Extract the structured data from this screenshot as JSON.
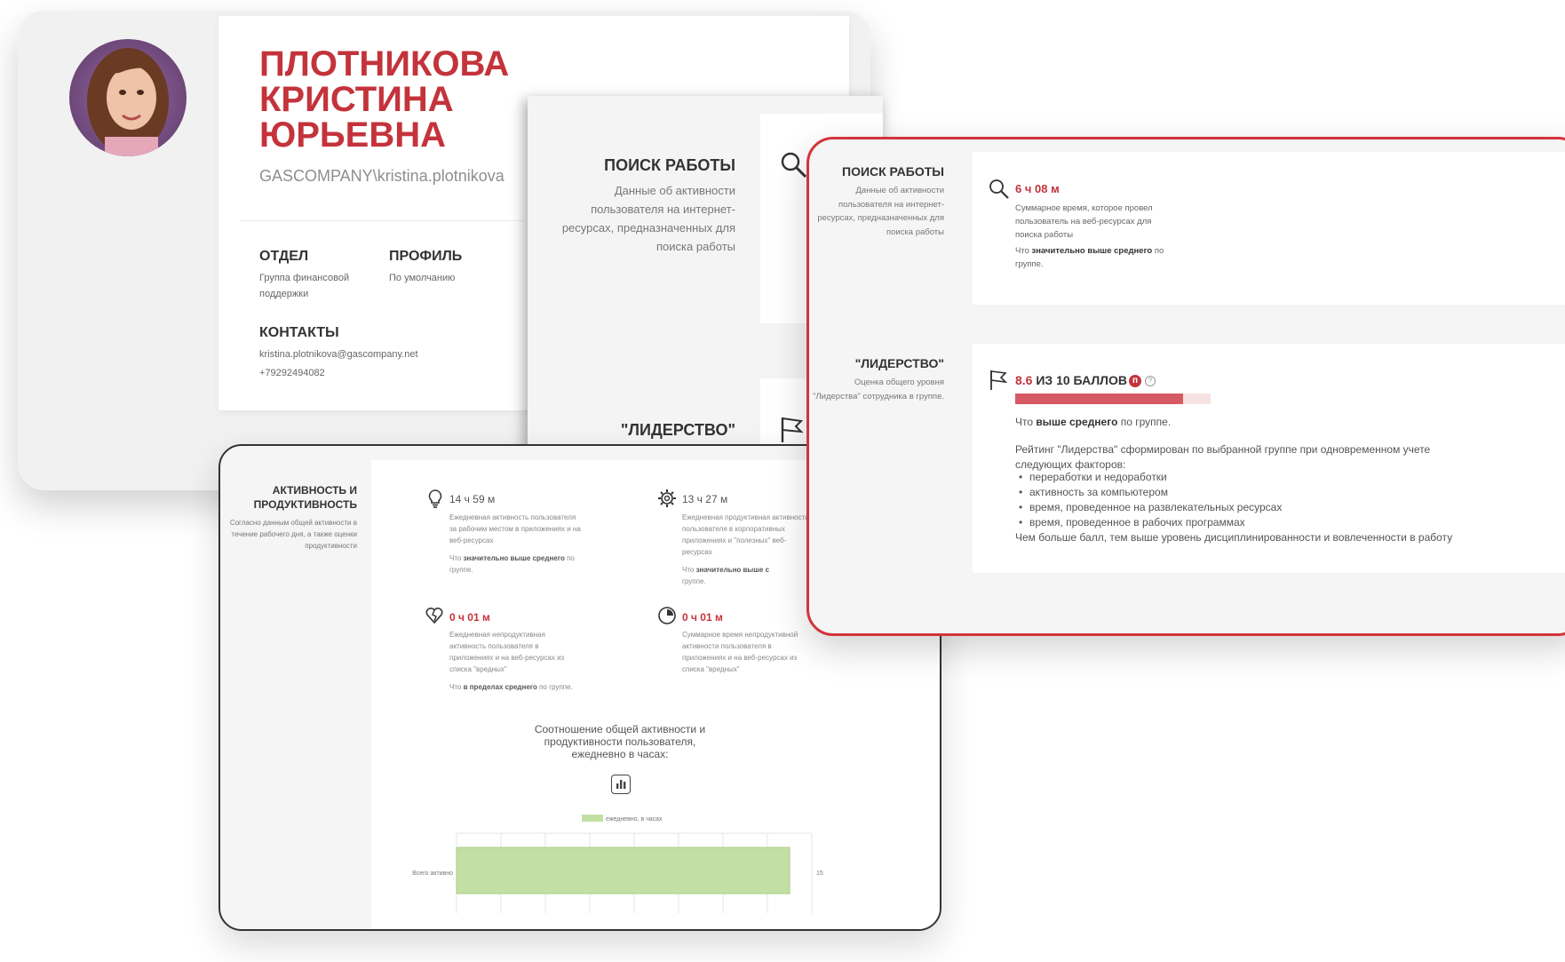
{
  "profile": {
    "last_name": "ПЛОТНИКОВА",
    "first_name": "КРИСТИНА",
    "patronymic": "ЮРЬЕВНА",
    "login": "GASCOMPANY\\kristina.plotnikova",
    "department_title": "ОТДЕЛ",
    "department_value": "Группа финансовой поддержки",
    "profile_title": "ПРОФИЛЬ",
    "profile_value": "По умолчанию",
    "contacts_title": "КОНТАКТЫ",
    "email": "kristina.plotnikova@gascompany.net",
    "phone": "+79292494082"
  },
  "job_back": {
    "title": "ПОИСК РАБОТЫ",
    "description": "Данные об активности пользователя на интернет-ресурсах, предназначенных для поиска работы",
    "leadership_title": "\"ЛИДЕРСТВО\""
  },
  "productivity": {
    "title": "АКТИВНОСТЬ И ПРОДУКТИВНОСТЬ",
    "description": "Согласно данным общей активности в течение рабочего дня, а также оценки продуктивности",
    "metrics": [
      {
        "icon": "lightbulb-icon",
        "value": "14 ч 59 м",
        "desc": "Ежедневная активность пользователя за рабочим местом в приложениях и на веб-ресурсах",
        "cmp_prefix": "Что ",
        "cmp_bold": "значительно выше среднего",
        "cmp_suffix": " по группе."
      },
      {
        "icon": "gear-icon",
        "value": "13 ч 27 м",
        "desc": "Ежедневная продуктивная активность пользователя в корпоративных приложениях и \"полезных\" веб-ресурсах",
        "cmp_prefix": "Что ",
        "cmp_bold": "значительно выше с",
        "cmp_suffix": "",
        "cmp_line2": "группе."
      },
      {
        "icon": "broken-heart-icon",
        "value": "0 ч 01 м",
        "desc": "Ежедневная непродуктивная активность пользователя в приложениях и на веб-ресурсах из списка \"вредных\"",
        "cmp_prefix": "Что ",
        "cmp_bold": "в пределах среднего",
        "cmp_suffix": " по группе."
      },
      {
        "icon": "clock-icon",
        "value": "0 ч 01 м",
        "desc": "Суммарное время непродуктивной активности пользователя в приложениях и на веб-ресурсах из списка \"вредных\"",
        "cmp_prefix": "",
        "cmp_bold": "",
        "cmp_suffix": ""
      }
    ],
    "chart_title": "Соотношение общей активности и продуктивности пользователя, ежедневно в часах:",
    "chart_icon": "bar-chart-icon"
  },
  "chart_data": {
    "type": "bar",
    "orientation": "horizontal",
    "categories": [
      "Всего активно"
    ],
    "series": [
      {
        "name": "ежедневно, в часах",
        "values": [
          15
        ],
        "color": "#c3dfa3"
      }
    ],
    "data_labels": [
      "15"
    ],
    "xlim": [
      0,
      16
    ],
    "grid": true,
    "legend": "top"
  },
  "red": {
    "job_title": "ПОИСК РАБОТЫ",
    "job_desc": "Данные об активности пользователя на интернет-ресурсах, предназначенных для поиска работы",
    "job_value": "6 ч 08 м",
    "job_detail": "Суммарное время, которое провел пользователь на веб-ресурсах для поиска работы",
    "job_cmp_prefix": "Что ",
    "job_cmp_bold": "значительно выше среднего",
    "job_cmp_suffix": " по группе.",
    "lead_title": "\"ЛИДЕРСТВО\"",
    "lead_desc": "Оценка общего уровня \"Лидерства\" сотрудника в группе.",
    "lead_score": "8.6",
    "lead_score_suffix": "ИЗ 10 БАЛЛОВ",
    "lead_badge": "п",
    "lead_help": "?",
    "lead_progress": 0.86,
    "lead_cmp_prefix": "Что ",
    "lead_cmp_bold": "выше среднего",
    "lead_cmp_suffix": " по группе.",
    "lead_rating_text": "Рейтинг \"Лидерства\" сформирован по выбранной группе при одновременном учете следующих факторов:",
    "factors": [
      "переработки и недоработки",
      "активность за компьютером",
      "время, проведенное на развлекательных ресурсах",
      "время, проведенное в рабочих программах"
    ],
    "lead_note": "Чем больше балл, тем выше уровень дисциплинированности и вовлеченности в работу"
  },
  "colors": {
    "accent": "#c4333b",
    "bar": "#c3dfa3",
    "progress": "#d55a63",
    "progress_bg": "#f7e2e3"
  }
}
